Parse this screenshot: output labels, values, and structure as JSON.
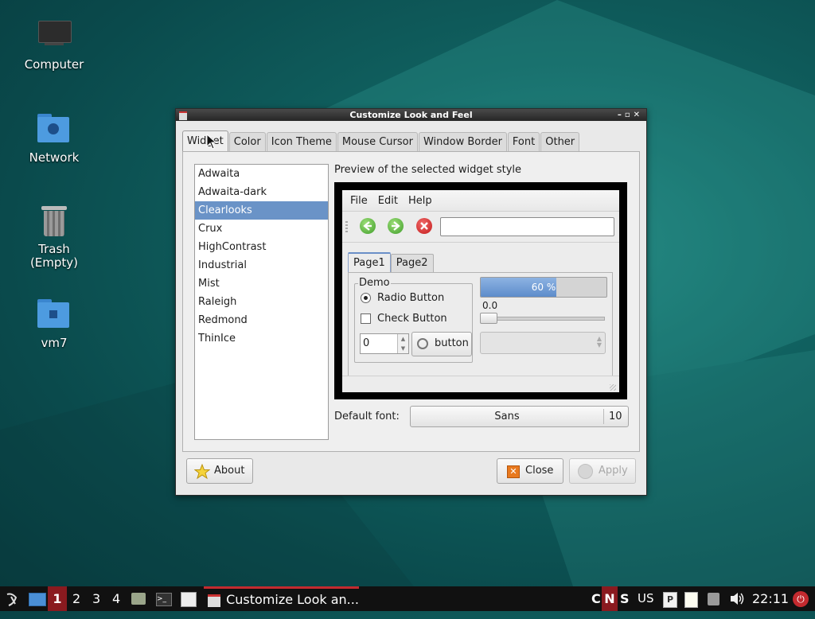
{
  "desktop": {
    "icons": [
      {
        "label": "Computer"
      },
      {
        "label": "Network"
      },
      {
        "label": "Trash\n(Empty)"
      },
      {
        "label": "vm7"
      }
    ]
  },
  "window": {
    "title": "Customize Look and Feel",
    "controls": {
      "minimize": "–",
      "maximize": "▫",
      "close": "✕"
    },
    "tabs": [
      "Widget",
      "Color",
      "Icon Theme",
      "Mouse Cursor",
      "Window Border",
      "Font",
      "Other"
    ],
    "active_tab": "Widget",
    "theme_list": [
      "Adwaita",
      "Adwaita-dark",
      "Clearlooks",
      "Crux",
      "HighContrast",
      "Industrial",
      "Mist",
      "Raleigh",
      "Redmond",
      "ThinIce"
    ],
    "selected_theme": "Clearlooks",
    "preview_label": "Preview of the selected widget style",
    "preview": {
      "menu": [
        "File",
        "Edit",
        "Help"
      ],
      "tabs": [
        "Page1",
        "Page2"
      ],
      "frame_title": "Demo",
      "radio_label": "Radio Button",
      "check_label": "Check Button",
      "spin_value": "0",
      "button_label": "button",
      "progress_text": "60 %",
      "progress_fraction": 0.6,
      "scale_value": "0.0",
      "entry_value": ""
    },
    "default_font_label": "Default font:",
    "font_name": "Sans",
    "font_size": "10",
    "about_label": "About",
    "close_label": "Close",
    "apply_label": "Apply"
  },
  "taskbar": {
    "workspaces": [
      "1",
      "2",
      "3",
      "4"
    ],
    "active_workspace": "1",
    "task_title": "Customize Look an...",
    "indicators": [
      "C",
      "N",
      "S"
    ],
    "layout": "US",
    "clock": "22:11"
  },
  "colors": {
    "selection": "#6a93c7",
    "accent_red": "#a51d24"
  }
}
